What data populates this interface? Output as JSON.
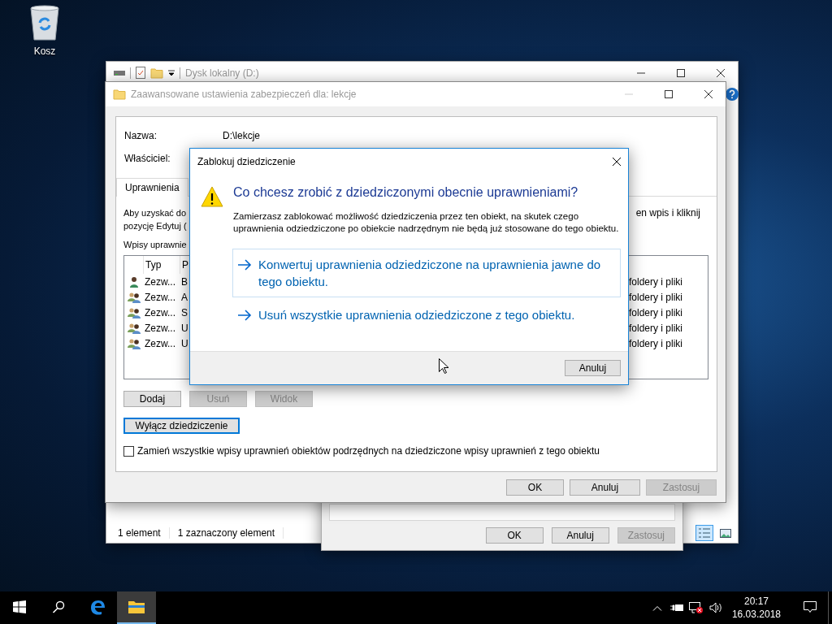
{
  "desktop": {
    "icons": [
      {
        "label": "Kosz"
      }
    ]
  },
  "explorer": {
    "title": "Dysk lokalny (D:)",
    "status_items": [
      "1 element",
      "1 zaznaczony element"
    ]
  },
  "properties_dialog": {
    "buttons": [
      {
        "label": "OK",
        "disabled": false
      },
      {
        "label": "Anuluj",
        "disabled": false
      },
      {
        "label": "Zastosuj",
        "disabled": true
      }
    ]
  },
  "security_window": {
    "title": "Zaawansowane ustawienia zabezpieczeń dla: lekcje",
    "fields": [
      {
        "label": "Nazwa:",
        "value": "D:\\lekcje"
      },
      {
        "label": "Właściciel:"
      }
    ],
    "tabs": [
      {
        "label": "Uprawnienia",
        "selected": true
      }
    ],
    "intro_lines": [
      "Aby uzyskać do",
      "pozycję Edytuj ("
    ],
    "intro_right": "en wpis i kliknij",
    "entries_label": "Wpisy uprawnie",
    "table": {
      "columns": [
        "Typ",
        "P"
      ],
      "rows": [
        {
          "kind": "user",
          "type": "Zezw...",
          "column_2": "B",
          "column_3": "foldery i pliki"
        },
        {
          "kind": "group",
          "type": "Zezw...",
          "column_2": "A",
          "column_3": "foldery i pliki"
        },
        {
          "kind": "group",
          "type": "Zezw...",
          "column_2": "S",
          "column_3": "foldery i pliki"
        },
        {
          "kind": "group",
          "type": "Zezw...",
          "column_2": "U",
          "column_3": "foldery i pliki"
        },
        {
          "kind": "group",
          "type": "Zezw...",
          "column_2": "U",
          "column_3": "foldery i pliki"
        }
      ]
    },
    "entry_buttons": [
      {
        "label": "Dodaj",
        "disabled": false
      },
      {
        "label": "Usuń",
        "disabled": true
      },
      {
        "label": "Widok",
        "disabled": true
      }
    ],
    "inheritance_button": {
      "label": "Wyłącz dziedziczenie",
      "focused": true
    },
    "replace_checkbox": {
      "label": "Zamień wszystkie wpisy uprawnień obiektów podrzędnych na dziedziczone wpisy uprawnień z tego obiektu",
      "checked": false
    },
    "footer_buttons": [
      {
        "label": "OK",
        "disabled": false
      },
      {
        "label": "Anuluj",
        "disabled": false
      },
      {
        "label": "Zastosuj",
        "disabled": true
      }
    ]
  },
  "modal": {
    "title": "Zablokuj dziedziczenie",
    "heading": "Co chcesz zrobić z dziedziczonymi obecnie uprawnieniami?",
    "message": "Zamierzasz zablokować możliwość dziedziczenia przez ten obiekt, na skutek czego uprawnienia odziedziczone po obiekcie nadrzędnym nie będą już stosowane do tego obiektu.",
    "options": [
      {
        "label": "Konwertuj uprawnienia odziedziczone na uprawnienia jawne do tego obiektu.",
        "selected": true
      },
      {
        "label": "Usuń wszystkie uprawnienia odziedziczone z tego obiektu.",
        "selected": false
      }
    ],
    "cancel": "Anuluj"
  },
  "taskbar": {
    "apps": [
      {
        "kind": "edge",
        "active": false
      },
      {
        "kind": "explorer",
        "active": true
      }
    ],
    "time": "20:17",
    "date": "16.03.2018"
  }
}
